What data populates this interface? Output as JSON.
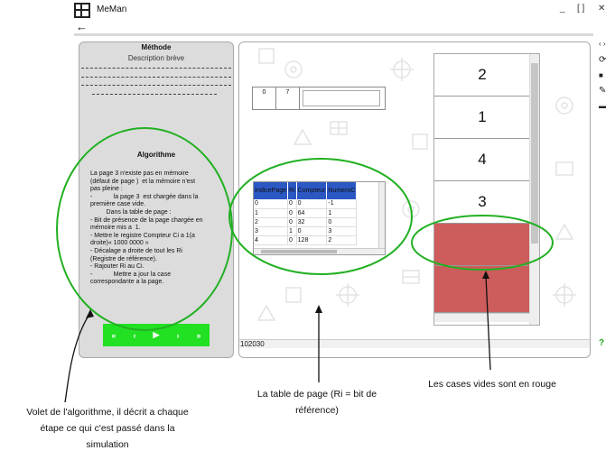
{
  "window": {
    "title": "MeMan",
    "minimize": "_",
    "maximize": "[ ]",
    "close": "✕",
    "back": "←"
  },
  "left_panel": {
    "methode_title": "Méthode",
    "methode_desc": "Description brève",
    "algo_title": "Algorithme",
    "algo_text": "La page 3 n'existe pas en mémoire\n(défaut de page )  et la mémoire n'est\npas pleine :\n-            la page 3  est chargée dans la\npremière case vide.\n         Dans la table de page :\n- Bit de présence de la page chargée en\nmémoire mis a  1.\n- Mettre le registre Compteur Ci a 1(a\ndroite)« 1000 0000 »\n- Décalage a droite de tout les Ri\n(Registre de référence).\n- Rajouter Ri au Ci.\n-            Mettre a jour la case\ncorrespondante a la page."
  },
  "controls": {
    "rewind": "«",
    "prev": "‹",
    "play": "▶",
    "next": "›",
    "forward": "»"
  },
  "register": {
    "c1": "0",
    "c2": "7"
  },
  "page_table": {
    "headers": [
      "IndicePage",
      "Ri",
      "Compteur",
      "NumeroC"
    ],
    "rows": [
      [
        "0",
        "0",
        "0",
        "-1"
      ],
      [
        "1",
        "0",
        "64",
        "1"
      ],
      [
        "2",
        "0",
        "32",
        "0"
      ],
      [
        "3",
        "1",
        "0",
        "3"
      ],
      [
        "4",
        "0",
        "128",
        "2"
      ]
    ]
  },
  "frames": [
    "2",
    "1",
    "4",
    "3",
    "",
    ""
  ],
  "clock": "102030",
  "toolbar": {
    "nav_icon": "‹ ›",
    "refresh_icon": "⟳",
    "save_icon": "■",
    "edit_icon": "✎",
    "folder_icon": "▬",
    "help_icon": "?"
  },
  "annotations": {
    "algo": "Volet de l'algorithme,  il décrit a chaque\nétape ce qui c'est passé dans la\nsimulation",
    "table": "La table de page (Ri = bit de\nréférence)",
    "empty": "Les cases vides sont en rouge"
  },
  "colors": {
    "controls_bg": "#22e022",
    "table_header": "#2c58c4",
    "empty_frame": "#cd5c5c",
    "annotation_ellipse": "#22b022",
    "help": "#22aa22"
  }
}
